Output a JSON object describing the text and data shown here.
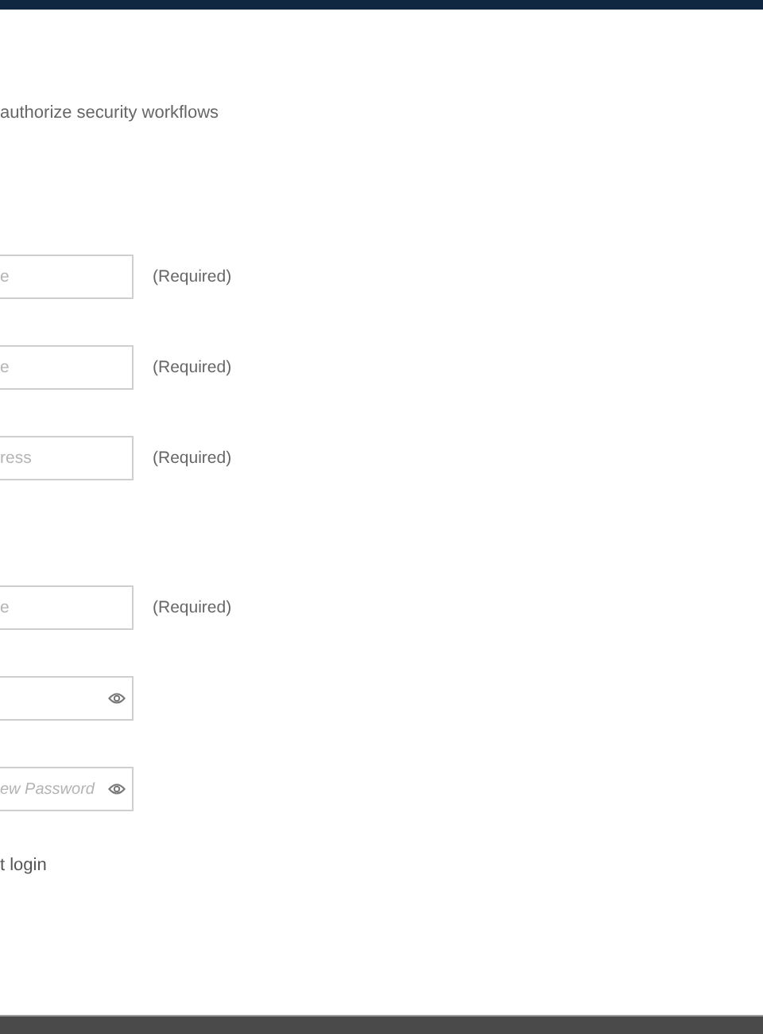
{
  "subtitle": "authorize security workflows",
  "sections": [
    {
      "fields": [
        {
          "kind": "text",
          "placeholder": "e",
          "note": "(Required)"
        },
        {
          "kind": "text",
          "placeholder": "e",
          "note": "(Required)"
        },
        {
          "kind": "text",
          "placeholder": "ress",
          "note": "(Required)"
        }
      ]
    },
    {
      "fields": [
        {
          "kind": "text",
          "placeholder": "e",
          "note": "(Required)"
        },
        {
          "kind": "password"
        },
        {
          "kind": "password",
          "placeholder": "ew Password"
        }
      ]
    }
  ],
  "footer_text": "t login"
}
